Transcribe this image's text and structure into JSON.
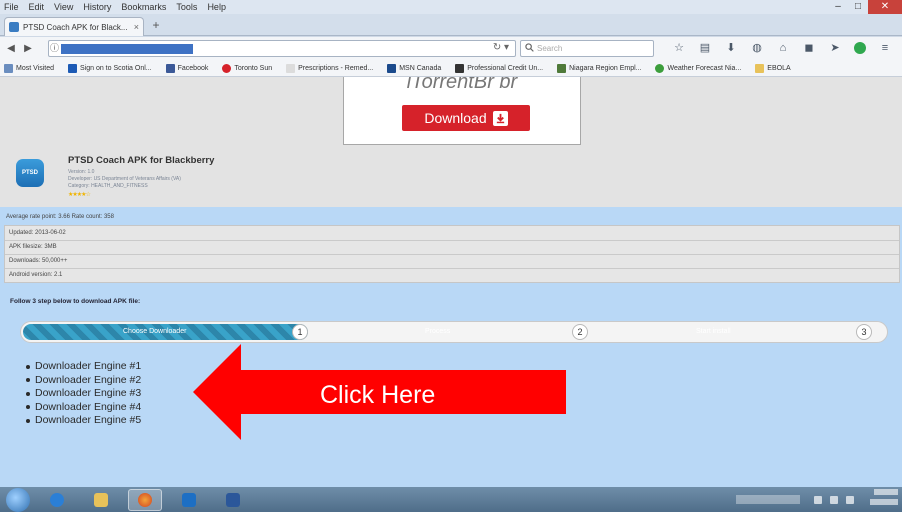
{
  "browser": {
    "menu": [
      "File",
      "Edit",
      "View",
      "History",
      "Bookmarks",
      "Tools",
      "Help"
    ],
    "window_controls": {
      "minimize": "–",
      "maximize": "□",
      "close": "✕"
    },
    "tab": {
      "title": "PTSD Coach APK for Black...",
      "close": "×"
    },
    "new_tab": "+",
    "nav": {
      "back": "◀",
      "forward": "▶",
      "info": "ⓘ",
      "reload": "↻ ▾"
    },
    "search": {
      "placeholder": "Search"
    },
    "toolbar_icons": [
      "star-icon",
      "bookmark-list-icon",
      "download-icon",
      "pocket-icon",
      "home-icon",
      "chat-icon",
      "send-icon",
      "extension-icon",
      "menu-icon"
    ],
    "bookmarks": [
      "Most Visited",
      "Sign on to Scotia Onl...",
      "Facebook",
      "Toronto Sun",
      "Prescriptions - Remed...",
      "MSN Canada",
      "Professional Credit Un...",
      "Niagara Region Empl...",
      "Weather Forecast Nia...",
      "EBOLA"
    ]
  },
  "ad": {
    "brand": "iTorrentBr br",
    "download_label": "Download",
    "accent_color": "#d6222a"
  },
  "app": {
    "icon_text": "PTSD",
    "title": "PTSD Coach APK for Blackberry",
    "meta": [
      "Version: 1.0",
      "Developer: US Department of Veterans Affairs (VA)",
      "Category: HEALTH_AND_FITNESS"
    ],
    "stars": "★★★★☆",
    "rating_line": "Average rate point: 3.66  Rate count: 358",
    "details": [
      "Updated: 2013-06-02",
      "APK filesize: 3MB",
      "Downloads: 50,000++",
      "Android version: 2.1"
    ]
  },
  "steps": {
    "title": "Follow 3 step below to download APK file:",
    "items": [
      {
        "label": "Choose Downloader",
        "number": "1"
      },
      {
        "label": "Process",
        "number": "2"
      },
      {
        "label": "Start install",
        "number": "3"
      }
    ],
    "progress": 0.33
  },
  "engines": [
    "Downloader Engine #1",
    "Downloader Engine #2",
    "Downloader Engine #3",
    "Downloader Engine #4",
    "Downloader Engine #5"
  ],
  "callout": {
    "label": "Click Here",
    "color": "#ff0000"
  },
  "taskbar": {
    "apps": [
      "explorer-icon",
      "folder-icon",
      "firefox-icon",
      "outlook-icon",
      "word-icon"
    ]
  }
}
